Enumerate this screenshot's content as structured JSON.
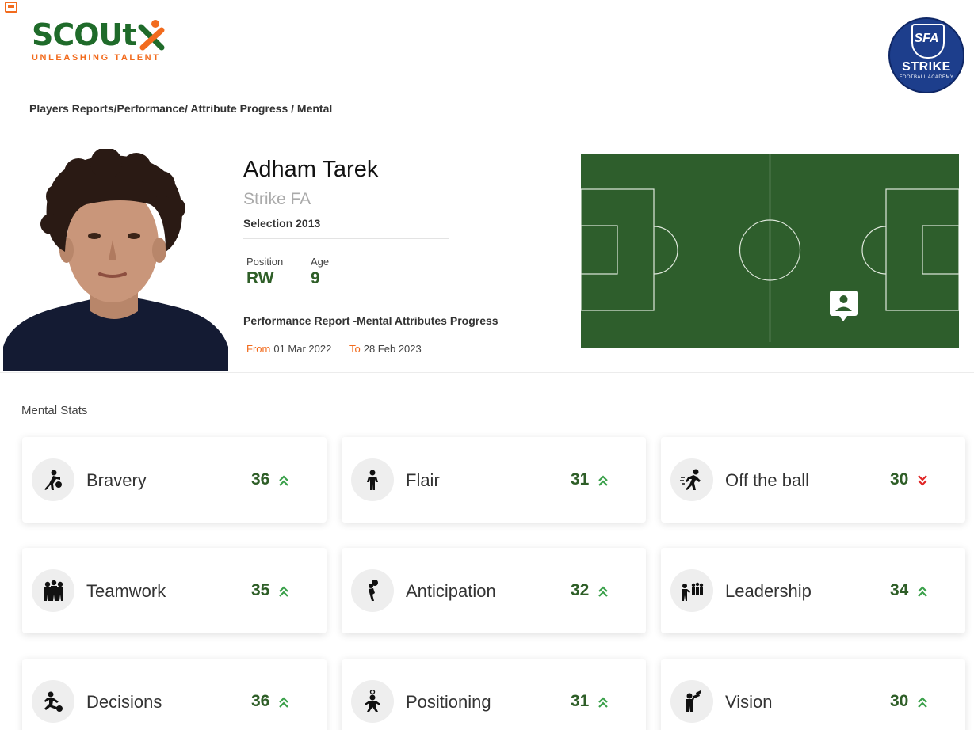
{
  "brand": {
    "name": "SCOUt",
    "tagline": "UNLEASHING TALENT",
    "colors": {
      "green": "#1f6b2a",
      "orange": "#f26b1d"
    }
  },
  "academy": {
    "badge_initials": "SFA",
    "badge_name": "STRIKE",
    "badge_subtitle": "FOOTBALL ACADEMY",
    "color": "#1d3e8c"
  },
  "breadcrumb": "Players Reports/Performance/ Attribute Progress / Mental",
  "player": {
    "name": "Adham Tarek",
    "club": "Strike FA",
    "selection": "Selection 2013",
    "position_label": "Position",
    "position": "RW",
    "age_label": "Age",
    "age": "9",
    "report_title": "Performance Report -Mental Attributes Progress",
    "from_label": "From",
    "from_date": "01 Mar 2022",
    "to_label": "To",
    "to_date": "28 Feb 2023"
  },
  "pitch": {
    "color": "#2e5e2c",
    "marker_icon": "player-location-icon"
  },
  "section_title": "Mental Stats",
  "stats": [
    {
      "name": "Bravery",
      "value": "36",
      "trend": "up",
      "icon": "bravery-icon"
    },
    {
      "name": "Flair",
      "value": "31",
      "trend": "up",
      "icon": "flair-icon"
    },
    {
      "name": "Off the ball",
      "value": "30",
      "trend": "down",
      "icon": "off-the-ball-icon"
    },
    {
      "name": "Teamwork",
      "value": "35",
      "trend": "up",
      "icon": "teamwork-icon"
    },
    {
      "name": "Anticipation",
      "value": "32",
      "trend": "up",
      "icon": "anticipation-icon"
    },
    {
      "name": "Leadership",
      "value": "34",
      "trend": "up",
      "icon": "leadership-icon"
    },
    {
      "name": "Decisions",
      "value": "36",
      "trend": "up",
      "icon": "decisions-icon"
    },
    {
      "name": "Positioning",
      "value": "31",
      "trend": "up",
      "icon": "positioning-icon"
    },
    {
      "name": "Vision",
      "value": "30",
      "trend": "up",
      "icon": "vision-icon"
    }
  ],
  "trend_colors": {
    "up": "#3aa04a",
    "down": "#e02424"
  }
}
